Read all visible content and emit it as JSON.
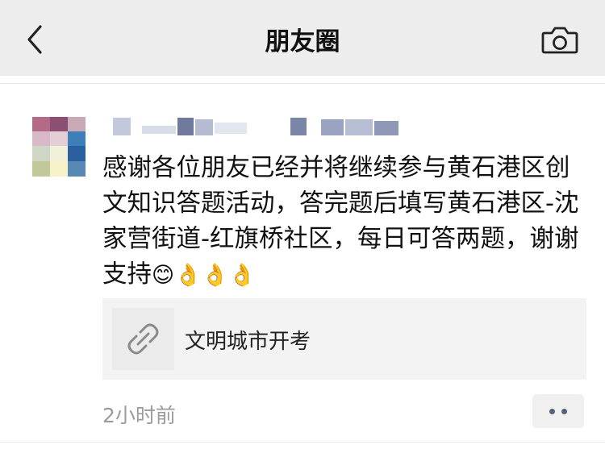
{
  "navbar": {
    "title": "朋友圈",
    "back_icon": "chevron-left-icon",
    "camera_icon": "camera-icon"
  },
  "post": {
    "text": "感谢各位朋友已经并将继续参与黄石港区创文知识答题活动，答完题后填写黄石港区-沈家营街道-红旗桥社区，每日可答两题，谢谢支持",
    "emojis": [
      "😊",
      "👌",
      "👌",
      "👌"
    ],
    "link": {
      "title": "文明城市开考",
      "icon": "link-icon"
    },
    "timestamp": "2小时前",
    "more_icon": "more-dots-icon"
  },
  "colors": {
    "navbar_bg": "#ededed",
    "link_card_bg": "#f3f3f3",
    "timestamp": "#9b9b9b",
    "more_dots": "#55607a"
  }
}
